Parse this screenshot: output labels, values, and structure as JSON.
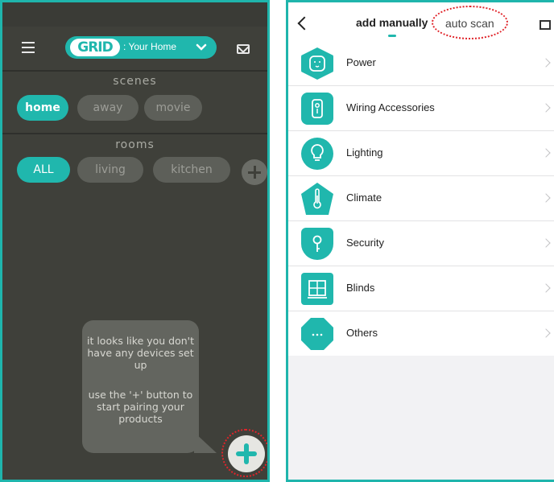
{
  "left_app": {
    "logo_text": "GRID",
    "home_selector": ": Your Home",
    "scenes_title": "scenes",
    "scenes": [
      {
        "label": "home",
        "active": true
      },
      {
        "label": "away",
        "active": false
      },
      {
        "label": "movie",
        "active": false
      }
    ],
    "rooms_title": "rooms",
    "rooms": [
      {
        "label": "ALL",
        "active": true
      },
      {
        "label": "living",
        "active": false
      },
      {
        "label": "kitchen",
        "active": false
      }
    ],
    "empty_message_1": "it looks like you don't have any devices set up",
    "empty_message_2": "use the '+' button to start pairing your products"
  },
  "right_app": {
    "tabs": {
      "manual": "add manually",
      "auto": "auto scan"
    },
    "categories": [
      {
        "label": "Power",
        "icon": "power-outlet-icon"
      },
      {
        "label": "Wiring Accessories",
        "icon": "wall-switch-icon"
      },
      {
        "label": "Lighting",
        "icon": "lightbulb-icon"
      },
      {
        "label": "Climate",
        "icon": "thermometer-icon"
      },
      {
        "label": "Security",
        "icon": "key-icon"
      },
      {
        "label": "Blinds",
        "icon": "window-icon"
      },
      {
        "label": "Others",
        "icon": "more-icon"
      }
    ]
  },
  "colors": {
    "accent": "#20b7ad",
    "dark_bg": "#3f403a",
    "highlight": "#e0242a"
  }
}
